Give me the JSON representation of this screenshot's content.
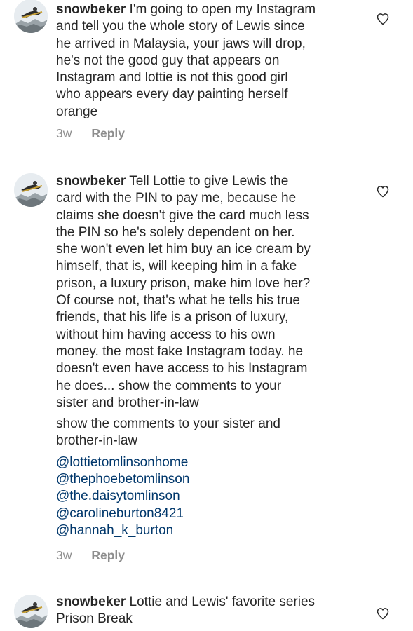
{
  "comments": [
    {
      "username": "snowbeker",
      "lines": [
        "I'm going to open my Instagram",
        "and tell you the whole story of Lewis since",
        "he arrived in Malaysia, your jaws will drop,",
        "he's not the good guy that appears on",
        "Instagram and lottie is not this good girl",
        "who appears every day painting herself",
        "orange"
      ],
      "time": "3w",
      "reply_label": "Reply"
    },
    {
      "username": "snowbeker",
      "lines": [
        "Tell Lottie to give Lewis the",
        "card with the PIN to pay me, because he",
        "claims she doesn't give the card much less",
        "the PIN so he's solely dependent on her.",
        "she won't even let him buy an ice cream by",
        "himself, that is, will keeping him in a fake",
        "prison, a luxury prison, make him love her?",
        "Of course not, that's what he tells his true",
        "friends, that his life is a prison of luxury,",
        "without him having access to his own",
        "money.  the most fake Instagram today.  he",
        "doesn't even have access to his Instagram",
        "he does... show the comments to your",
        "sister and brother-in-law"
      ],
      "extra_lines": [
        "show the comments to your sister and",
        "brother-in-law"
      ],
      "mentions": [
        "@lottietomlinsonhome",
        "@thephoebetomlinson",
        "@the.daisytomlinson",
        "@carolineburton8421",
        "@hannah_k_burton"
      ],
      "time": "3w",
      "reply_label": "Reply"
    },
    {
      "username": "snowbeker",
      "lines": [
        "Lottie and Lewis' favorite series",
        "Prison Break"
      ]
    }
  ],
  "colors": {
    "text": "#262626",
    "muted": "#8e8e8e",
    "mention": "#00376b"
  },
  "icons": {
    "like": "heart-outline-icon",
    "avatar": "snowboarder-avatar"
  }
}
